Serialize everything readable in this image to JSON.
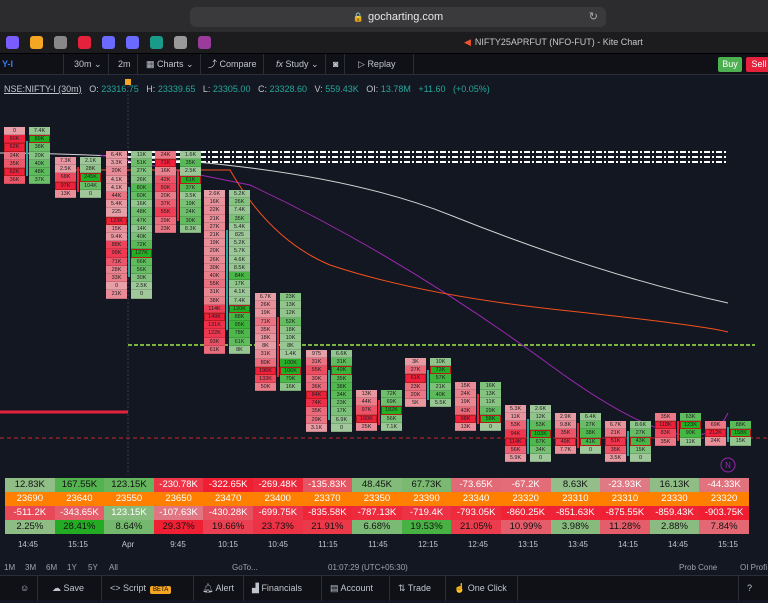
{
  "browser": {
    "url": "gocharting.com"
  },
  "tab": {
    "title": "NIFTY25APRFUT (NFO-FUT) - Kite Chart"
  },
  "favicons": [
    "#7b5cff",
    "#f5a623",
    "#888",
    "#e5213b",
    "#6a6aff",
    "#6a6aff",
    "#1a9b8a",
    "#999",
    "#9b3b9b"
  ],
  "toolbar": {
    "symbol": "Y-I",
    "interval": "30m",
    "interval2": "2m",
    "charts": "Charts",
    "compare": "Compare",
    "study": "Study",
    "replay": "Replay",
    "buy": "Buy",
    "sell": "Sell"
  },
  "ohlc": {
    "symbol": "NSE:NIFTY-I (30m)",
    "o_label": "O:",
    "o": "23316.75",
    "h_label": "H:",
    "h": "23339.65",
    "l_label": "L:",
    "l": "23305.00",
    "c_label": "C:",
    "c": "23328.60",
    "v_label": "V:",
    "v": "559.43K",
    "oi_label": "OI:",
    "oi": "13.78M",
    "chg": "+11.60",
    "chg_pct": "(+0.05%)"
  },
  "colors": {
    "bg": "#131722",
    "red": "#f0203c",
    "green": "#22b022",
    "orange": "#ff7f00",
    "white_line": "#d0d0d0",
    "purple_line": "#9c27b0",
    "orange_line": "#f4511e"
  },
  "footprint": [
    {
      "sell": [
        "0",
        "60K",
        "62K",
        "24K",
        "35K",
        "62K",
        "36K"
      ],
      "buy": [
        "7.4K",
        "89K",
        "38K",
        "20K",
        "40K",
        "48K",
        "37K"
      ]
    },
    {
      "sell": [
        "7.3K",
        "2.5K",
        "68K",
        "97K",
        "13K"
      ],
      "buy": [
        "2.1K",
        "28K",
        "245K",
        "104K",
        "0"
      ]
    },
    {
      "sell": [
        "6.4K",
        "3.3K",
        "20K",
        "4.1K",
        "4.1K",
        "44K",
        "5.4K",
        "225",
        "123K",
        "15K",
        "9.4K",
        "88K",
        "99K",
        "71K",
        "28K",
        "33K",
        "0",
        "21K"
      ],
      "buy": [
        "11K",
        "51K",
        "27K",
        "26K",
        "80K",
        "60K",
        "16K",
        "48K",
        "47K",
        "14K",
        "40K",
        "72K",
        "127K",
        "66K",
        "56K",
        "30K",
        "2.5K",
        "0"
      ]
    },
    {
      "sell": [
        "24K",
        "71K",
        "16K",
        "42K",
        "50K",
        "20K",
        "37K",
        "55K",
        "29K",
        "23K"
      ],
      "buy": [
        "1.6K",
        "35K",
        "2.5K",
        "61K",
        "37K",
        "3.5K",
        "19K",
        "24K",
        "30K",
        "8.3K"
      ]
    },
    {
      "sell": [
        "2.6K",
        "16K",
        "22K",
        "21K",
        "27K",
        "21K",
        "19K",
        "20K",
        "26K",
        "30K",
        "40K",
        "55K",
        "31K",
        "38K",
        "114K",
        "149K",
        "131K",
        "122K",
        "93K",
        "61K"
      ],
      "buy": [
        "5.2K",
        "26K",
        "7.4K",
        "35K",
        "5.4K",
        "825",
        "5.2K",
        "5.7K",
        "4.6K",
        "8.5K",
        "84K",
        "17K",
        "4.1K",
        "7.4K",
        "120K",
        "88K",
        "95K",
        "78K",
        "61K",
        "8K"
      ]
    },
    {
      "sell": [
        "6.7K",
        "26K",
        "19K",
        "71K",
        "35K",
        "18K",
        "8K",
        "31K",
        "80K",
        "196K",
        "133K",
        "50K"
      ],
      "buy": [
        "23K",
        "13K",
        "12K",
        "52K",
        "18K",
        "10K",
        "8K",
        "1.4K",
        "100K",
        "106K",
        "70K",
        "16K"
      ]
    },
    {
      "sell": [
        "975",
        "31K",
        "55K",
        "30K",
        "36K",
        "84K",
        "74K",
        "35K",
        "29K",
        "3.1K"
      ],
      "buy": [
        "6.6K",
        "31K",
        "49K",
        "35K",
        "38K",
        "34K",
        "23K",
        "17K",
        "6.9K",
        "0"
      ]
    },
    {
      "sell": [
        "13K",
        "44K",
        "97K",
        "160K",
        "25K"
      ],
      "buy": [
        "72K",
        "69K",
        "182K",
        "56K",
        "7.1K"
      ]
    },
    {
      "sell": [
        "3K",
        "27K",
        "61K",
        "23K",
        "20K",
        "5K"
      ],
      "buy": [
        "10K",
        "73K",
        "57K",
        "21K",
        "40K",
        "5.5K"
      ]
    },
    {
      "sell": [
        "15K",
        "24K",
        "19K",
        "43K",
        "98K",
        "13K"
      ],
      "buy": [
        "16K",
        "13K",
        "11K",
        "29K",
        "58K",
        "0"
      ]
    },
    {
      "sell": [
        "5.3K",
        "11K",
        "53K",
        "94K",
        "114K",
        "56K",
        "5.9K"
      ],
      "buy": [
        "2.6K",
        "12K",
        "53K",
        "103K",
        "67K",
        "34K",
        "0"
      ]
    },
    {
      "sell": [
        "2.9K",
        "9.8K",
        "35K",
        "49K",
        "7.7K"
      ],
      "buy": [
        "6.4K",
        "27K",
        "38K",
        "41K",
        "0"
      ]
    },
    {
      "sell": [
        "6.7K",
        "21K",
        "51K",
        "35K",
        "3.5K"
      ],
      "buy": [
        "8.6K",
        "27K",
        "43K",
        "15K",
        "0"
      ]
    },
    {
      "sell": [
        "35K",
        "118K",
        "83K",
        "35K"
      ],
      "buy": [
        "63K",
        "123K",
        "90K",
        "11K"
      ]
    },
    {
      "sell": [
        "69K",
        "212K",
        "24K"
      ],
      "buy": [
        "88K",
        "158K",
        "15K"
      ]
    }
  ],
  "table": {
    "delta": [
      "12.83K",
      "167.55K",
      "123.15K",
      "-230.78K",
      "-322.65K",
      "-269.48K",
      "-135.83K",
      "48.45K",
      "67.73K",
      "-73.65K",
      "-67.2K",
      "8.63K",
      "-23.93K",
      "16.13K",
      "-44.33K"
    ],
    "poc": [
      "23690",
      "23640",
      "23550",
      "23650",
      "23470",
      "23400",
      "23370",
      "23350",
      "23390",
      "23340",
      "23320",
      "23310",
      "23310",
      "23330",
      "23320"
    ],
    "cum_delta": [
      "-511.2K",
      "-343.65K",
      "123.15K",
      "-107.63K",
      "-430.28K",
      "-699.75K",
      "-835.58K",
      "-787.13K",
      "-719.4K",
      "-793.05K",
      "-860.25K",
      "-851.63K",
      "-875.55K",
      "-859.43K",
      "-903.75K"
    ],
    "pct": [
      "2.25%",
      "28.41%",
      "8.64%",
      "29.37%",
      "19.66%",
      "23.73%",
      "21.91%",
      "6.68%",
      "19.53%",
      "21.05%",
      "10.99%",
      "3.98%",
      "11.28%",
      "2.88%",
      "7.84%"
    ],
    "pct_sign": [
      1,
      1,
      1,
      -1,
      -1,
      -1,
      -1,
      1,
      1,
      -1,
      -1,
      1,
      -1,
      1,
      -1
    ]
  },
  "time_axis": [
    "14:45",
    "15:15",
    "Apr",
    "9:45",
    "10:15",
    "10:45",
    "11:15",
    "11:45",
    "12:15",
    "12:45",
    "13:15",
    "13:45",
    "14:15",
    "14:45",
    "15:15"
  ],
  "range_bar": {
    "ranges": [
      "1M",
      "3M",
      "6M",
      "1Y",
      "5Y",
      "All"
    ],
    "clock": "01:07:29 (UTC+05:30)",
    "goto": "GoTo...",
    "prob_cone": "Prob Cone",
    "oi_profile": "OI Profi"
  },
  "bottom_bar": {
    "save": "Save",
    "script": "Script",
    "beta": "BETA",
    "alert": "Alert",
    "financials": "Financials",
    "account": "Account",
    "trade": "Trade",
    "one_click": "One Click",
    "help": "?"
  },
  "marker": "N"
}
